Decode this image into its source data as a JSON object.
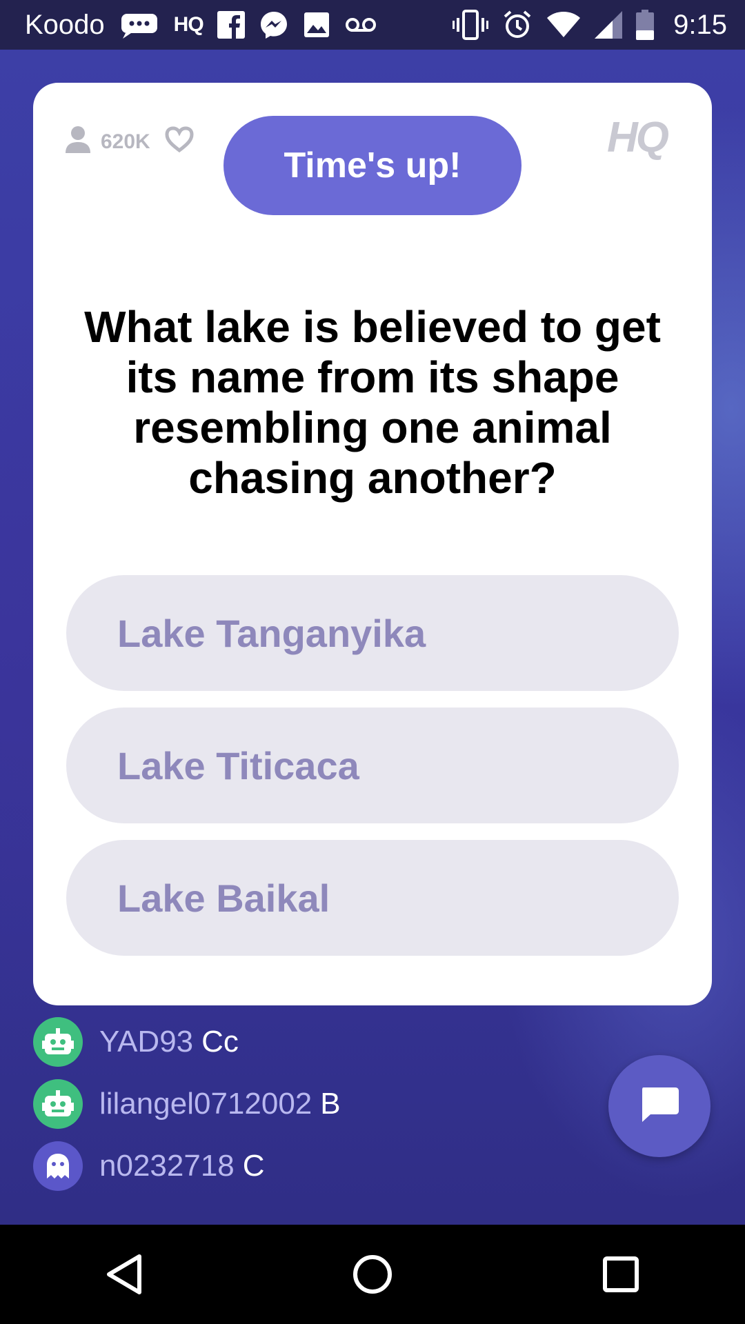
{
  "status_bar": {
    "carrier": "Koodo",
    "hq_label": "HQ",
    "time": "9:15",
    "icons": [
      "sms-icon",
      "hq-icon",
      "facebook-icon",
      "messenger-icon",
      "gallery-icon",
      "voicemail-icon",
      "vibrate-icon",
      "alarm-icon",
      "wifi-icon",
      "signal-icon",
      "battery-icon"
    ]
  },
  "card": {
    "viewers_count": "620K",
    "timer_label": "Time's up!",
    "logo_text": "HQ",
    "question": "What lake is believed to get its name from its shape resembling one animal chasing another?",
    "answers": [
      {
        "label": "Lake Tanganyika"
      },
      {
        "label": "Lake Titicaca"
      },
      {
        "label": "Lake Baikal"
      }
    ]
  },
  "chat": {
    "messages": [
      {
        "user": "YAD93",
        "text": "Cc",
        "avatar": "robot-icon"
      },
      {
        "user": "lilangel0712002",
        "text": "B",
        "avatar": "robot-icon"
      },
      {
        "user": "n0232718",
        "text": "C",
        "avatar": "ghost-icon"
      }
    ]
  },
  "colors": {
    "accent": "#6b6ad6",
    "answer_bg": "#e8e7ef",
    "answer_text": "#8e88bb",
    "robot_avatar": "#3fbf7f"
  }
}
